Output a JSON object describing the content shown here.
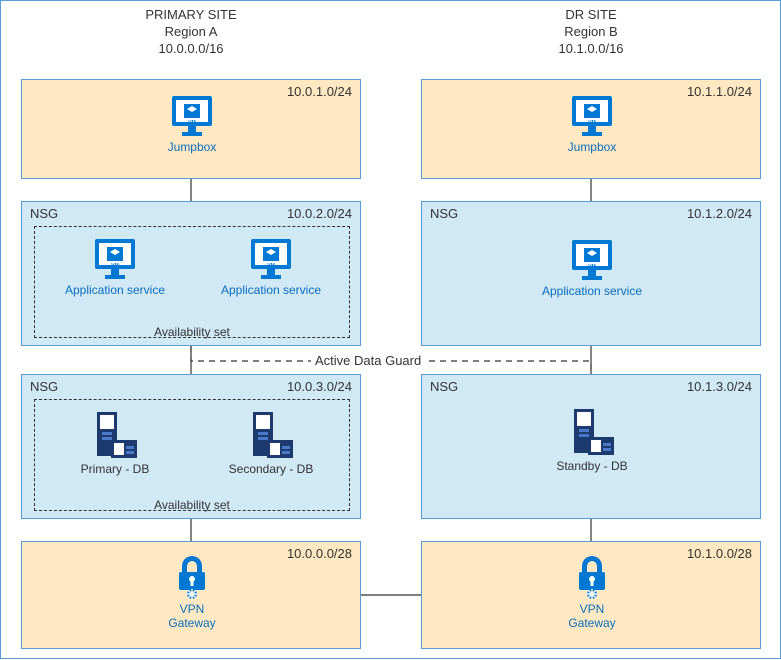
{
  "sites": {
    "primary": {
      "title": "PRIMARY SITE",
      "region": "Region A",
      "cidr": "10.0.0.0/16"
    },
    "dr": {
      "title": "DR SITE",
      "region": "Region B",
      "cidr": "10.1.0.0/16"
    }
  },
  "zones": {
    "p_jump": {
      "cidr": "10.0.1.0/24"
    },
    "p_app": {
      "nsg": "NSG",
      "cidr": "10.0.2.0/24",
      "avset": "Availability set"
    },
    "p_db": {
      "nsg": "NSG",
      "cidr": "10.0.3.0/24",
      "avset": "Availability set"
    },
    "p_vpn": {
      "cidr": "10.0.0.0/28"
    },
    "d_jump": {
      "cidr": "10.1.1.0/24"
    },
    "d_app": {
      "nsg": "NSG",
      "cidr": "10.1.2.0/24"
    },
    "d_db": {
      "nsg": "NSG",
      "cidr": "10.1.3.0/24"
    },
    "d_vpn": {
      "cidr": "10.1.0.0/28"
    }
  },
  "nodes": {
    "p_jump": {
      "label": "Jumpbox"
    },
    "p_app1": {
      "label": "Application service"
    },
    "p_app2": {
      "label": "Application service"
    },
    "p_db1": {
      "label": "Primary - DB"
    },
    "p_db2": {
      "label": "Secondary - DB"
    },
    "p_vpn": {
      "label1": "VPN",
      "label2": "Gateway"
    },
    "d_jump": {
      "label": "Jumpbox"
    },
    "d_app": {
      "label": "Application service"
    },
    "d_db": {
      "label": "Standby - DB"
    },
    "d_vpn": {
      "label1": "VPN",
      "label2": "Gateway"
    }
  },
  "adg_label": "Active Data Guard"
}
